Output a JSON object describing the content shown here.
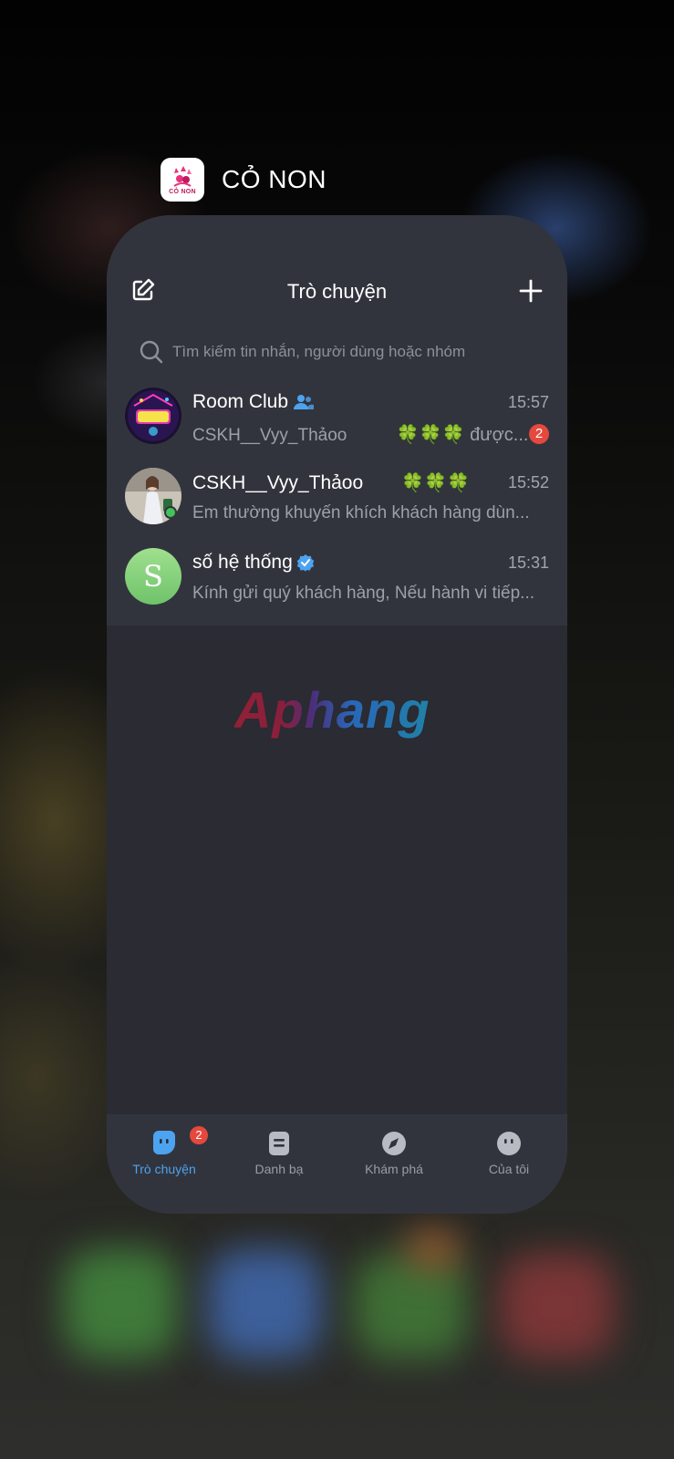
{
  "app": {
    "name": "CỎ NON",
    "icon": "co-non-logo",
    "icon_text": "CỎ NON"
  },
  "header": {
    "title": "Trò chuyện",
    "edit_icon": "edit-icon",
    "add_icon": "plus-icon"
  },
  "search": {
    "placeholder": "Tìm kiếm tin nhắn, người dùng hoặc nhóm",
    "icon": "search-icon"
  },
  "chats": [
    {
      "name": "Room Club",
      "name_icon": "group-icon",
      "time": "15:57",
      "preview": "CSKH__Vyy_Thảoo",
      "preview_deco": "🍀🍀🍀 được...",
      "unread": "2",
      "avatar": "room-club-avatar"
    },
    {
      "name": "CSKH__Vyy_Thảoo",
      "name_deco": "🍀🍀🍀",
      "time": "15:52",
      "preview": "Em thường khuyến khích khách hàng dùn...",
      "online": true,
      "avatar": "user-photo-avatar"
    },
    {
      "name": "số hệ thống",
      "name_icon": "verified-icon",
      "time": "15:31",
      "preview": "Kính gửi quý khách hàng, Nếu hành vi tiếp...",
      "avatar_letter": "S"
    }
  ],
  "watermark": "Aphang",
  "tabs": [
    {
      "label": "Trò chuyện",
      "icon": "chat-icon",
      "active": true,
      "badge": "2"
    },
    {
      "label": "Danh bạ",
      "icon": "contacts-icon"
    },
    {
      "label": "Khám phá",
      "icon": "compass-icon"
    },
    {
      "label": "Của tôi",
      "icon": "profile-icon"
    }
  ],
  "colors": {
    "accent": "#4da3f0",
    "badge": "#e5483d",
    "card_bg": "#2a2b33",
    "panel_bg": "#32343d",
    "online": "#42c35a"
  }
}
